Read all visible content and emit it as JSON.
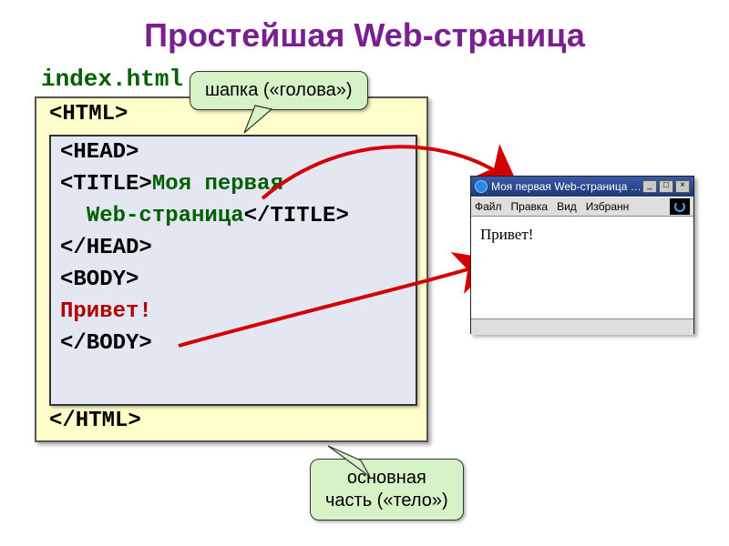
{
  "title": "Простейшая Web-страница",
  "filename": "index.html",
  "code": {
    "html_open": "<HTML>",
    "head_open": "<HEAD>",
    "title_open": "<TITLE>",
    "title_text1": "Моя первая",
    "title_text2": "Web-страница",
    "title_close": "</TITLE>",
    "head_close": "</HEAD>",
    "body_open": "<BODY>",
    "body_text": "Привет!",
    "body_close": "</BODY>",
    "html_close": "</HTML>"
  },
  "callouts": {
    "head": "шапка («голова»)",
    "body_line1": "основная",
    "body_line2": "часть («тело»)"
  },
  "browser": {
    "window_title": "Моя первая Web-страница …",
    "menu": {
      "file": "Файл",
      "edit": "Правка",
      "view": "Вид",
      "fav": "Избранн"
    },
    "content": "Привет!",
    "buttons": {
      "min": "_",
      "max": "□",
      "close": "×"
    }
  }
}
